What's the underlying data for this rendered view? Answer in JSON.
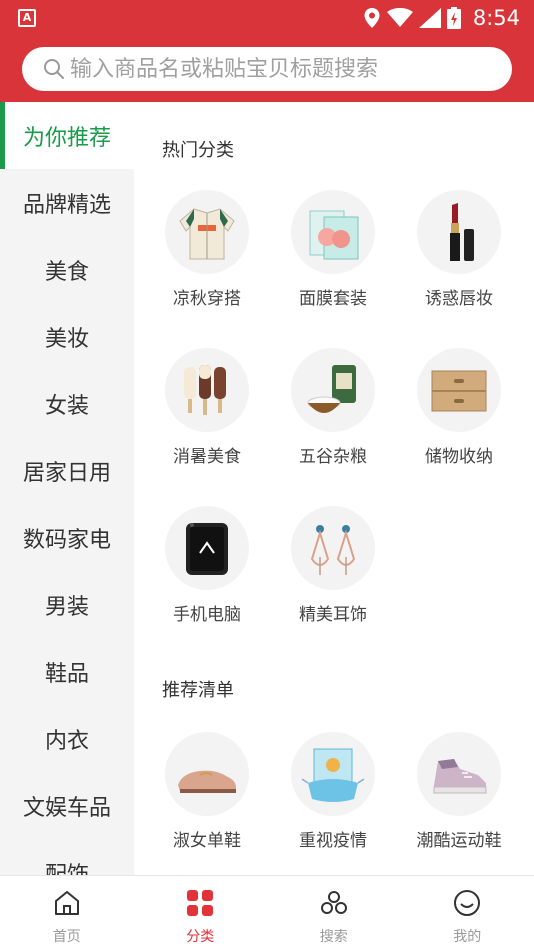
{
  "status": {
    "app_badge": "A",
    "time": "8:54"
  },
  "search": {
    "placeholder": "输入商品名或粘贴宝贝标题搜索"
  },
  "sidebar": {
    "items": [
      {
        "label": "为你推荐"
      },
      {
        "label": "品牌精选"
      },
      {
        "label": "美食"
      },
      {
        "label": "美妆"
      },
      {
        "label": "女装"
      },
      {
        "label": "居家日用"
      },
      {
        "label": "数码家电"
      },
      {
        "label": "男装"
      },
      {
        "label": "鞋品"
      },
      {
        "label": "内衣"
      },
      {
        "label": "文娱车品"
      },
      {
        "label": "配饰"
      }
    ]
  },
  "hot": {
    "title": "热门分类",
    "items": [
      {
        "label": "凉秋穿搭",
        "icon": "jacket-icon"
      },
      {
        "label": "面膜套装",
        "icon": "face-mask-box-icon"
      },
      {
        "label": "诱惑唇妆",
        "icon": "lipstick-icon"
      },
      {
        "label": "消暑美食",
        "icon": "popsicle-icon"
      },
      {
        "label": "五谷杂粮",
        "icon": "rice-bag-icon"
      },
      {
        "label": "储物收纳",
        "icon": "storage-drawer-icon"
      },
      {
        "label": "手机电脑",
        "icon": "rugged-phone-icon"
      },
      {
        "label": "精美耳饰",
        "icon": "earrings-icon"
      }
    ]
  },
  "recommend": {
    "title": "推荐清单",
    "items": [
      {
        "label": "淑女单鞋",
        "icon": "loafer-icon"
      },
      {
        "label": "重视疫情",
        "icon": "medical-mask-icon"
      },
      {
        "label": "潮酷运动鞋",
        "icon": "sneaker-icon"
      }
    ]
  },
  "tabbar": {
    "tabs": [
      {
        "label": "首页",
        "icon": "home-icon"
      },
      {
        "label": "分类",
        "icon": "category-grid-icon"
      },
      {
        "label": "搜索",
        "icon": "search-circles-icon"
      },
      {
        "label": "我的",
        "icon": "profile-smile-icon"
      }
    ]
  },
  "colors": {
    "brand_red": "#d8343a",
    "active_green": "#1a9a4a",
    "tab_active": "#e2323a"
  }
}
